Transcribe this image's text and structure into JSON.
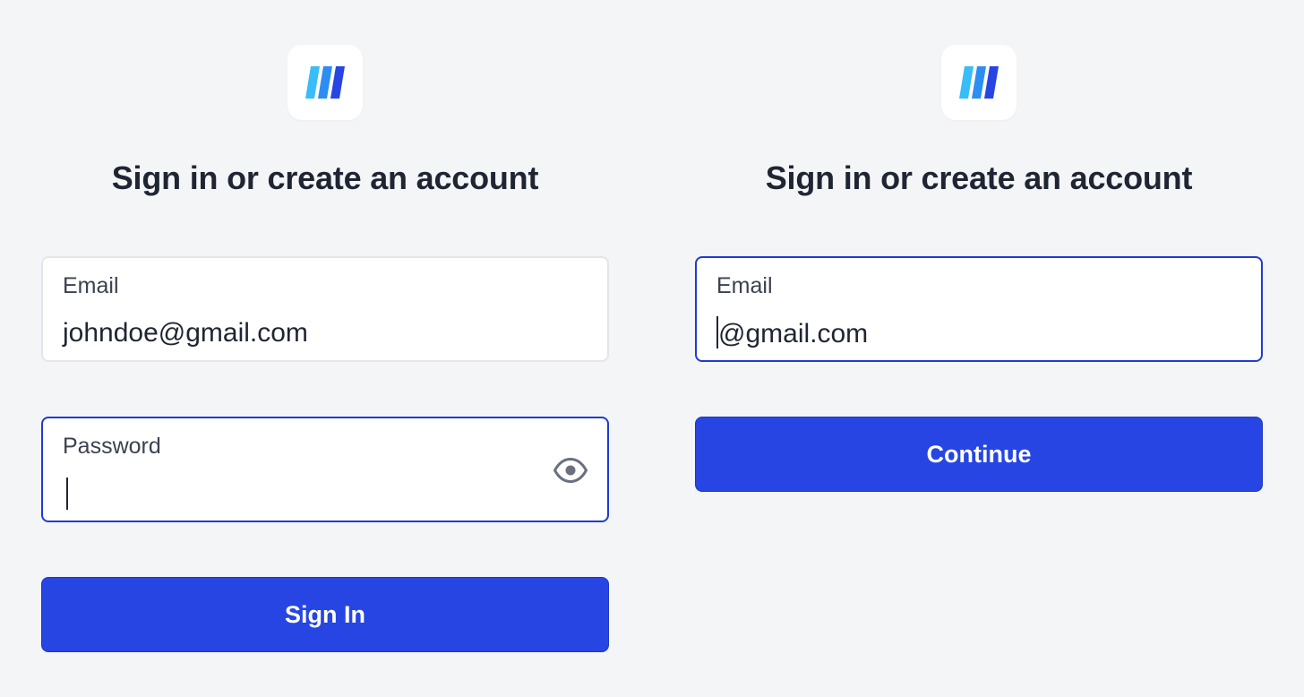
{
  "brand": {
    "logo_icon": "striped-logo-icon",
    "colors": [
      "#38bdf8",
      "#2c8ef2",
      "#2645e3"
    ]
  },
  "sign_in_panel": {
    "title": "Sign in or create an account",
    "email": {
      "label": "Email",
      "value": "johndoe@gmail.com"
    },
    "password": {
      "label": "Password",
      "value": "",
      "toggle_icon": "eye-icon"
    },
    "submit_label": "Sign In"
  },
  "email_panel": {
    "title": "Sign in or create an account",
    "email": {
      "label": "Email",
      "value": "@gmail.com"
    },
    "submit_label": "Continue"
  },
  "colors": {
    "background": "#f4f5f7",
    "accent": "#2645e3",
    "focus_border": "#1f3bd0",
    "text": "#1f2533"
  }
}
